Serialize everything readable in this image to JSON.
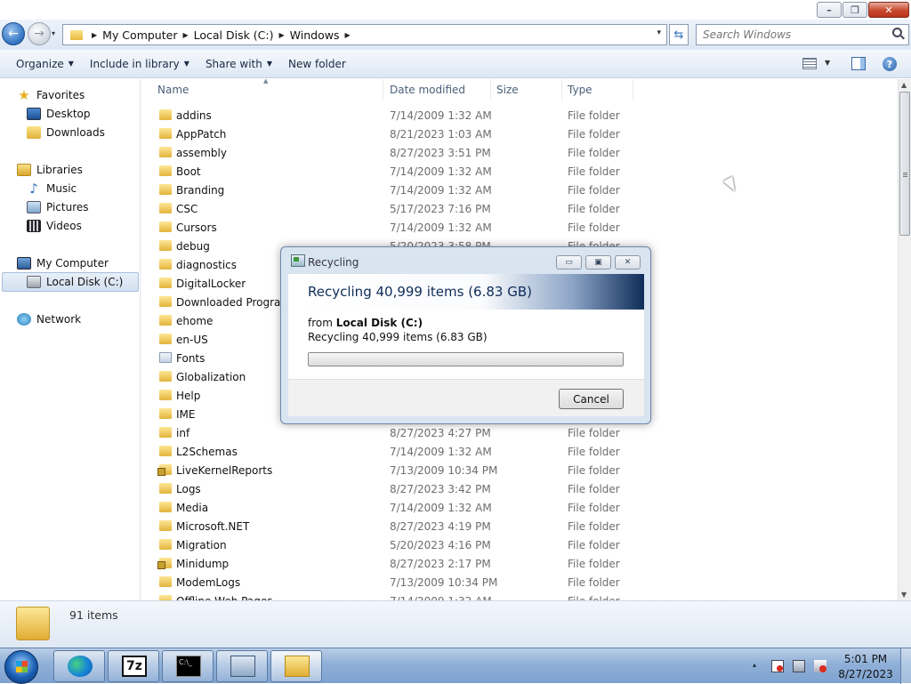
{
  "caption": {
    "minimize": "–",
    "maximize": "❐",
    "close": "✕"
  },
  "address": {
    "back": "←",
    "forward": "→",
    "dropdown": "▾",
    "crumbs": [
      "My Computer",
      "Local Disk (C:)",
      "Windows"
    ],
    "search_placeholder": "Search Windows"
  },
  "toolbar": {
    "organize": "Organize",
    "include": "Include in library",
    "share": "Share with",
    "newfolder": "New folder",
    "help": "?"
  },
  "nav": {
    "favorites": "Favorites",
    "desktop": "Desktop",
    "downloads": "Downloads",
    "libraries": "Libraries",
    "music": "Music",
    "pictures": "Pictures",
    "videos": "Videos",
    "computer": "My Computer",
    "disk": "Local Disk (C:)",
    "network": "Network"
  },
  "columns": {
    "name": "Name",
    "date": "Date modified",
    "size": "Size",
    "type": "Type"
  },
  "files": [
    {
      "name": "addins",
      "date": "7/14/2009 1:32 AM",
      "type": "File folder"
    },
    {
      "name": "AppPatch",
      "date": "8/21/2023 1:03 AM",
      "type": "File folder"
    },
    {
      "name": "assembly",
      "date": "8/27/2023 3:51 PM",
      "type": "File folder"
    },
    {
      "name": "Boot",
      "date": "7/14/2009 1:32 AM",
      "type": "File folder"
    },
    {
      "name": "Branding",
      "date": "7/14/2009 1:32 AM",
      "type": "File folder"
    },
    {
      "name": "CSC",
      "date": "5/17/2023 7:16 PM",
      "type": "File folder"
    },
    {
      "name": "Cursors",
      "date": "7/14/2009 1:32 AM",
      "type": "File folder"
    },
    {
      "name": "debug",
      "date": "5/20/2023 3:58 PM",
      "type": "File folder"
    },
    {
      "name": "diagnostics",
      "date": "",
      "type": ""
    },
    {
      "name": "DigitalLocker",
      "date": "",
      "type": ""
    },
    {
      "name": "Downloaded Program",
      "date": "",
      "type": ""
    },
    {
      "name": "ehome",
      "date": "",
      "type": ""
    },
    {
      "name": "en-US",
      "date": "",
      "type": ""
    },
    {
      "name": "Fonts",
      "date": "",
      "type": ""
    },
    {
      "name": "Globalization",
      "date": "",
      "type": ""
    },
    {
      "name": "Help",
      "date": "",
      "type": ""
    },
    {
      "name": "IME",
      "date": "",
      "type": ""
    },
    {
      "name": "inf",
      "date": "8/27/2023 4:27 PM",
      "type": "File folder"
    },
    {
      "name": "L2Schemas",
      "date": "7/14/2009 1:32 AM",
      "type": "File folder"
    },
    {
      "name": "LiveKernelReports",
      "date": "7/13/2009 10:34 PM",
      "type": "File folder"
    },
    {
      "name": "Logs",
      "date": "8/27/2023 3:42 PM",
      "type": "File folder"
    },
    {
      "name": "Media",
      "date": "7/14/2009 1:32 AM",
      "type": "File folder"
    },
    {
      "name": "Microsoft.NET",
      "date": "8/27/2023 4:19 PM",
      "type": "File folder"
    },
    {
      "name": "Migration",
      "date": "5/20/2023 4:16 PM",
      "type": "File folder"
    },
    {
      "name": "Minidump",
      "date": "8/27/2023 2:17 PM",
      "type": "File folder"
    },
    {
      "name": "ModemLogs",
      "date": "7/13/2009 10:34 PM",
      "type": "File folder"
    },
    {
      "name": "Offline Web Pages",
      "date": "7/14/2009 1:32 AM",
      "type": "File folder"
    }
  ],
  "status": {
    "count": "91 items"
  },
  "dialog": {
    "title": "Recycling",
    "heading": "Recycling 40,999 items (6.83 GB)",
    "from": "from ",
    "source": "Local Disk (C:)",
    "detail": "Recycling 40,999 items (6.83 GB)",
    "progress": 0,
    "cancel": "Cancel",
    "min": "▭",
    "max": "▣",
    "close": "✕"
  },
  "taskbar": {
    "cmd_text": "C:\\_",
    "sevenzip": "7z",
    "show_hidden": "▴"
  },
  "clock": {
    "time": "5:01 PM",
    "date": "8/27/2023"
  }
}
